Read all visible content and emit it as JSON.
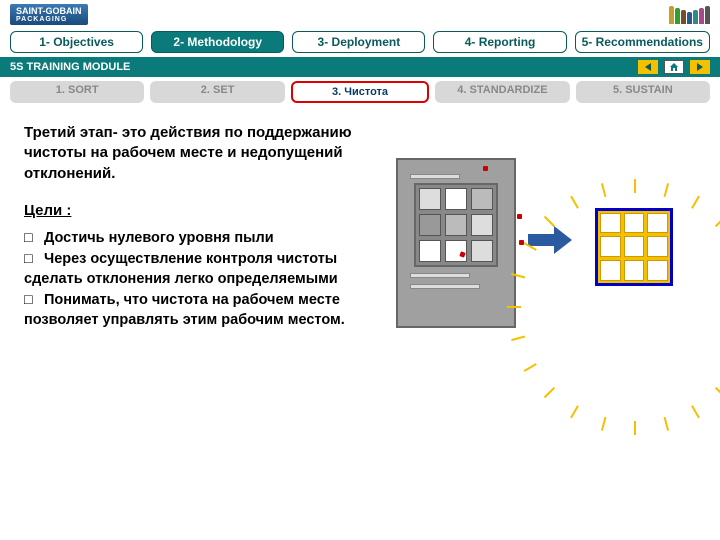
{
  "brand": {
    "name": "SAINT-GOBAIN",
    "sub": "PACKAGING"
  },
  "nav1": {
    "items": [
      {
        "label": "1- Objectives"
      },
      {
        "label": "2- Methodology"
      },
      {
        "label": "3- Deployment"
      },
      {
        "label": "4- Reporting"
      },
      {
        "label": "5- Recommendations"
      }
    ],
    "activeIndex": 1
  },
  "band": {
    "title": "5S TRAINING MODULE"
  },
  "nav2": {
    "items": [
      {
        "label": "1. SORT"
      },
      {
        "label": "2. SET"
      },
      {
        "label": "3. Чистота"
      },
      {
        "label": "4. STANDARDIZE"
      },
      {
        "label": "5. SUSTAIN"
      }
    ],
    "activeIndex": 2
  },
  "intro": "Третий этап- это действия по поддержанию чистоты на рабочем месте и недопущений отклонений.",
  "goals": {
    "heading": "Цели :",
    "items": [
      "Достичь нулевого уровня пыли",
      "Через осуществление контроля чистоты сделать отклонения легко определяемыми",
      "Понимать, что чистота на рабочем месте позволяет управлять этим рабочим местом."
    ]
  },
  "bottleColors": [
    "#c4a030",
    "#30a030",
    "#7a4a2a",
    "#2a5a8a",
    "#308a8a",
    "#a84a8a",
    "#555"
  ]
}
